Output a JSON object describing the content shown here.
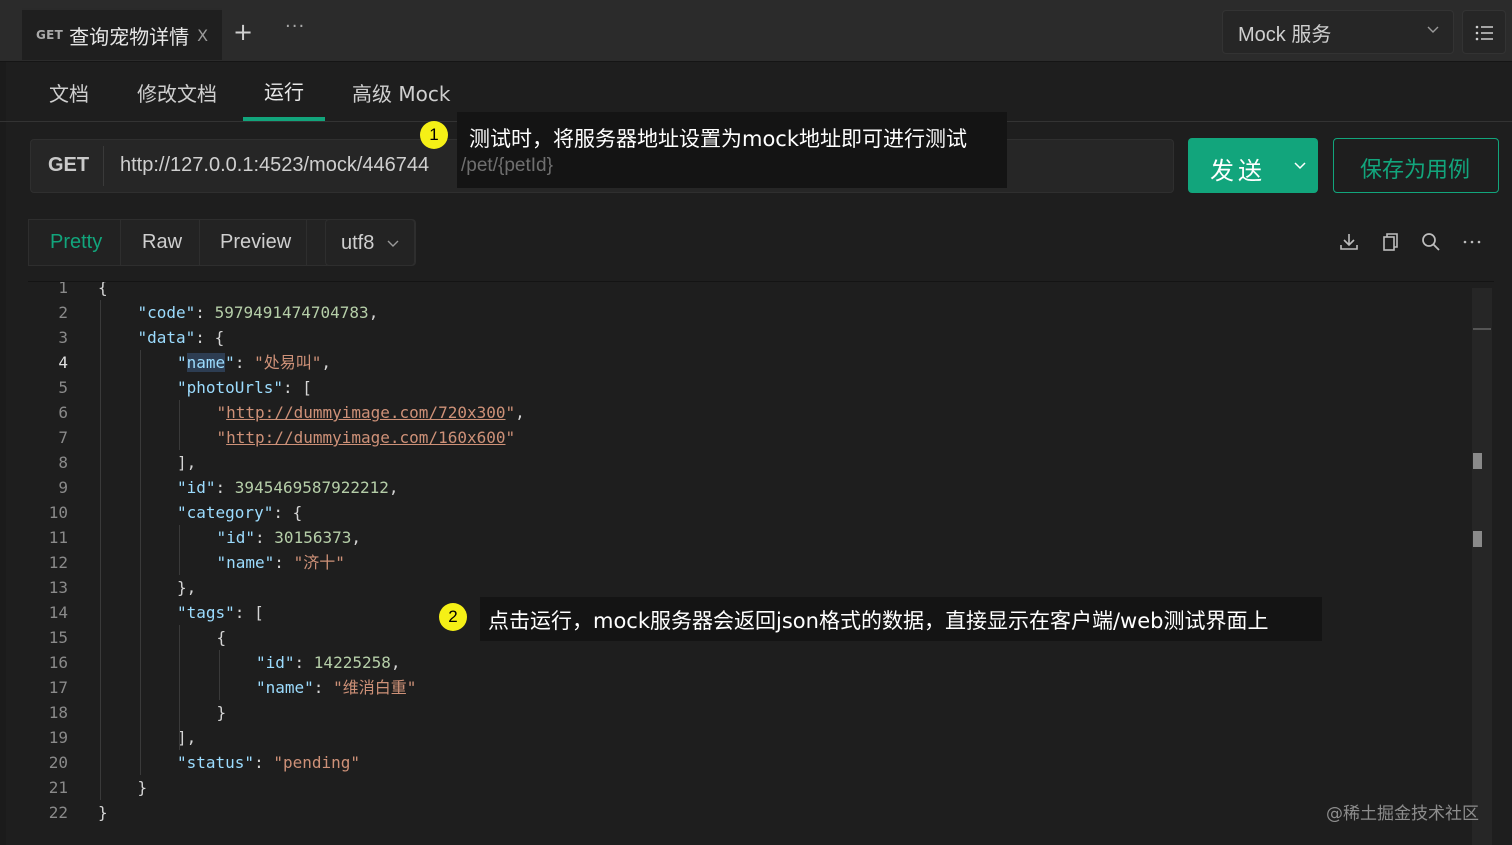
{
  "request_tab": {
    "method": "GET",
    "title": "查询宠物详情",
    "close_glyph": "X"
  },
  "tab_controls": {
    "add_glyph": "+",
    "more_glyph": "···"
  },
  "environment": {
    "label": "Mock 服务"
  },
  "subtabs": [
    {
      "label": "文档"
    },
    {
      "label": "修改文档"
    },
    {
      "label": "运行",
      "active": true
    },
    {
      "label": "高级 Mock"
    }
  ],
  "url_bar": {
    "method": "GET",
    "url": "http://127.0.0.1:4523/mock/446744",
    "path": "/pet/{petId}"
  },
  "buttons": {
    "send": "发送",
    "save_as_example": "保存为用例"
  },
  "response_view": {
    "tabs": [
      {
        "label": "Pretty",
        "active": true
      },
      {
        "label": "Raw"
      },
      {
        "label": "Preview"
      }
    ],
    "encoding": "utf8",
    "toolbar_icons": [
      "download-icon",
      "copy-icon",
      "search-icon",
      "more-icon"
    ]
  },
  "code_lines": [
    "{",
    "\"code\": 5979491474704783,",
    "\"data\": {",
    "\"name\": \"处易叫\",",
    "\"photoUrls\": [",
    "\"http://dummyimage.com/720x300\",",
    "\"http://dummyimage.com/160x600\"",
    "],",
    "\"id\": 3945469587922212,",
    "\"category\": {",
    "\"id\": 30156373,",
    "\"name\": \"济十\"",
    "},",
    "\"tags\": [",
    "{",
    "\"id\": 14225258,",
    "\"name\": \"维消白重\"",
    "}",
    "],",
    "\"status\": \"pending\"",
    "}",
    "}"
  ],
  "annotations": [
    {
      "number": "1",
      "text": "测试时，将服务器地址设置为mock地址即可进行测试"
    },
    {
      "number": "2",
      "text": "点击运行，mock服务器会返回json格式的数据，直接显示在客户端/web测试界面上"
    }
  ],
  "watermark": "@稀土掘金技术社区",
  "colors": {
    "accent": "#12a57c",
    "background": "#1e1e1e",
    "badge": "#f5f016"
  }
}
